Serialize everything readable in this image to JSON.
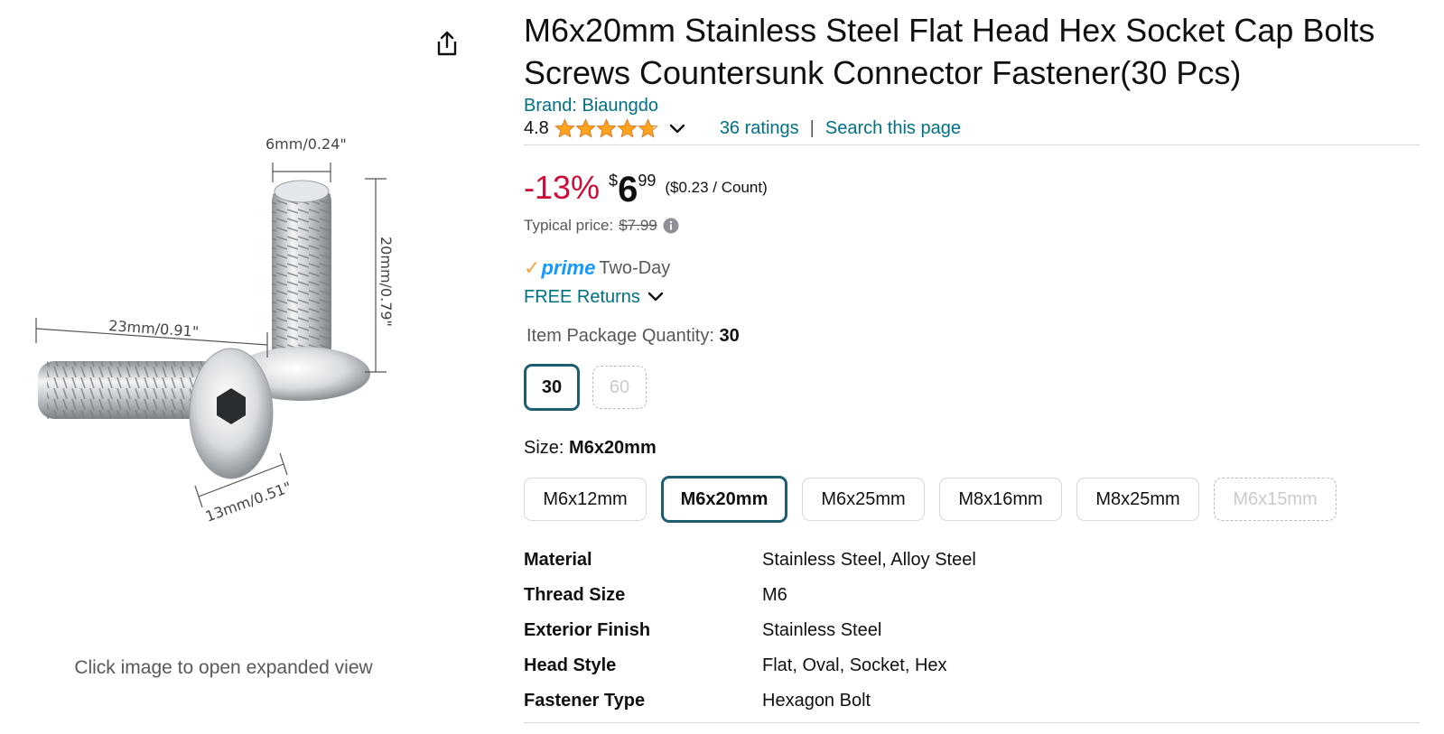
{
  "gallery": {
    "caption": "Click image to open expanded view",
    "dimensions": {
      "width": "6mm/0.24\"",
      "length": "20mm/0.79\"",
      "head_dia": "23mm/0.91\"",
      "thread_len": "13mm/0.51\""
    }
  },
  "product": {
    "title": "M6x20mm Stainless Steel Flat Head Hex Socket Cap Bolts Screws Countersunk Connector Fastener(30 Pcs)",
    "brand": "Brand: Biaungdo",
    "rating": "4.8",
    "stars": 4.8,
    "ratings_count": "36 ratings",
    "separator": "|",
    "search_link": "Search this page"
  },
  "price": {
    "discount": "-13%",
    "symbol": "$",
    "whole": "6",
    "fraction": "99",
    "unit_price": "($0.23 / Count)",
    "typical_label": "Typical price:",
    "typical_value": "$7.99"
  },
  "delivery": {
    "prime_check": "✓",
    "prime_word": "prime",
    "prime_speed": "Two-Day",
    "returns": "FREE Returns"
  },
  "quantity": {
    "label": "Item Package Quantity:",
    "selected": "30",
    "options": [
      "30",
      "60"
    ]
  },
  "size": {
    "label": "Size:",
    "selected": "M6x20mm",
    "options": [
      "M6x12mm",
      "M6x20mm",
      "M6x25mm",
      "M8x16mm",
      "M8x25mm",
      "M6x15mm"
    ]
  },
  "specs": [
    {
      "key": "Material",
      "value": "Stainless Steel, Alloy Steel"
    },
    {
      "key": "Thread Size",
      "value": "M6"
    },
    {
      "key": "Exterior Finish",
      "value": "Stainless Steel"
    },
    {
      "key": "Head Style",
      "value": "Flat, Oval, Socket, Hex"
    },
    {
      "key": "Fastener Type",
      "value": "Hexagon Bolt"
    }
  ],
  "colors": {
    "link": "#007185",
    "discount": "#cc0c39",
    "prime_blue": "#1399ff",
    "star": "#ffa41c",
    "selected_border": "#1c5d70"
  }
}
